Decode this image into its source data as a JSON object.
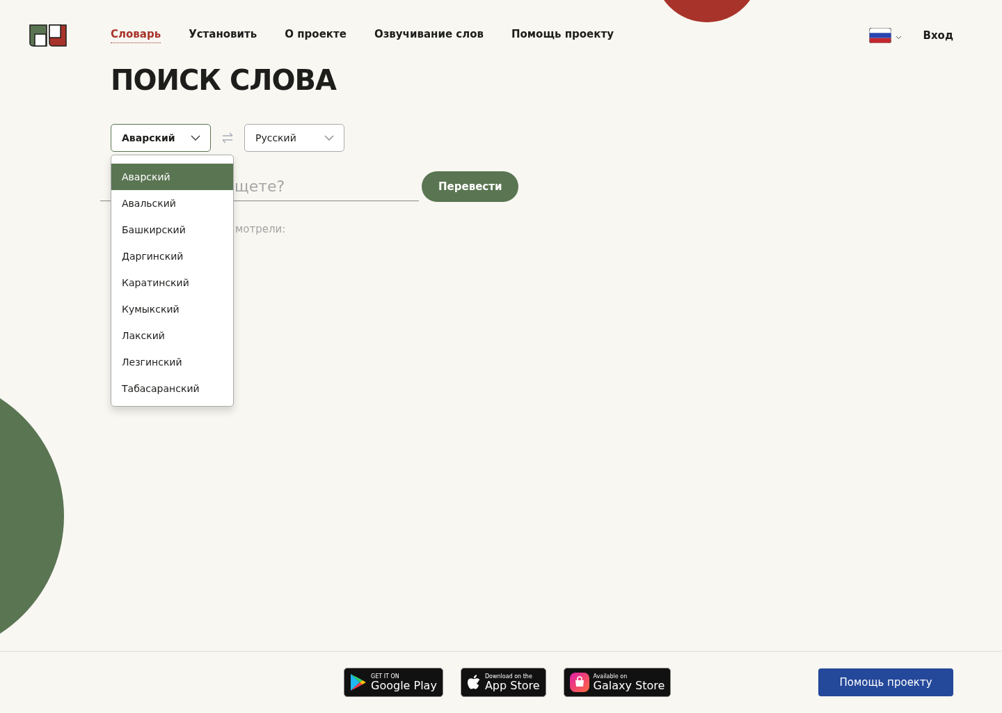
{
  "nav": {
    "items": [
      {
        "label": "Словарь",
        "selected": true
      },
      {
        "label": "Установить",
        "selected": false
      },
      {
        "label": "О проекте",
        "selected": false
      },
      {
        "label": "Озвучивание слов",
        "selected": false
      },
      {
        "label": "Помощь проекту",
        "selected": false
      }
    ],
    "login": "Вход"
  },
  "title": "ПОИСК СЛОВА",
  "source_language": {
    "value": "Аварский",
    "expanded": true,
    "options": [
      {
        "label": "Аварский",
        "selected": true
      },
      {
        "label": "Авальский",
        "selected": false
      },
      {
        "label": "Башкирский",
        "selected": false
      },
      {
        "label": "Даргинский",
        "selected": false
      },
      {
        "label": "Каратинский",
        "selected": false
      },
      {
        "label": "Кумыкский",
        "selected": false
      },
      {
        "label": "Лакский",
        "selected": false
      },
      {
        "label": "Лезгинский",
        "selected": false
      },
      {
        "label": "Табасаранский",
        "selected": false
      }
    ]
  },
  "target_language": {
    "value": "Русский"
  },
  "search": {
    "placeholder": "щете?",
    "button": "Перевести"
  },
  "recent_label": "мотрели:",
  "footer": {
    "stores": [
      {
        "kind": "google",
        "small": "GET IT ON",
        "big": "Google Play"
      },
      {
        "kind": "apple",
        "small": "Download on the",
        "big": "App Store"
      },
      {
        "kind": "galaxy",
        "small": "Available on",
        "big": "Galaxy Store"
      }
    ],
    "donate": "Помощь проекту"
  }
}
